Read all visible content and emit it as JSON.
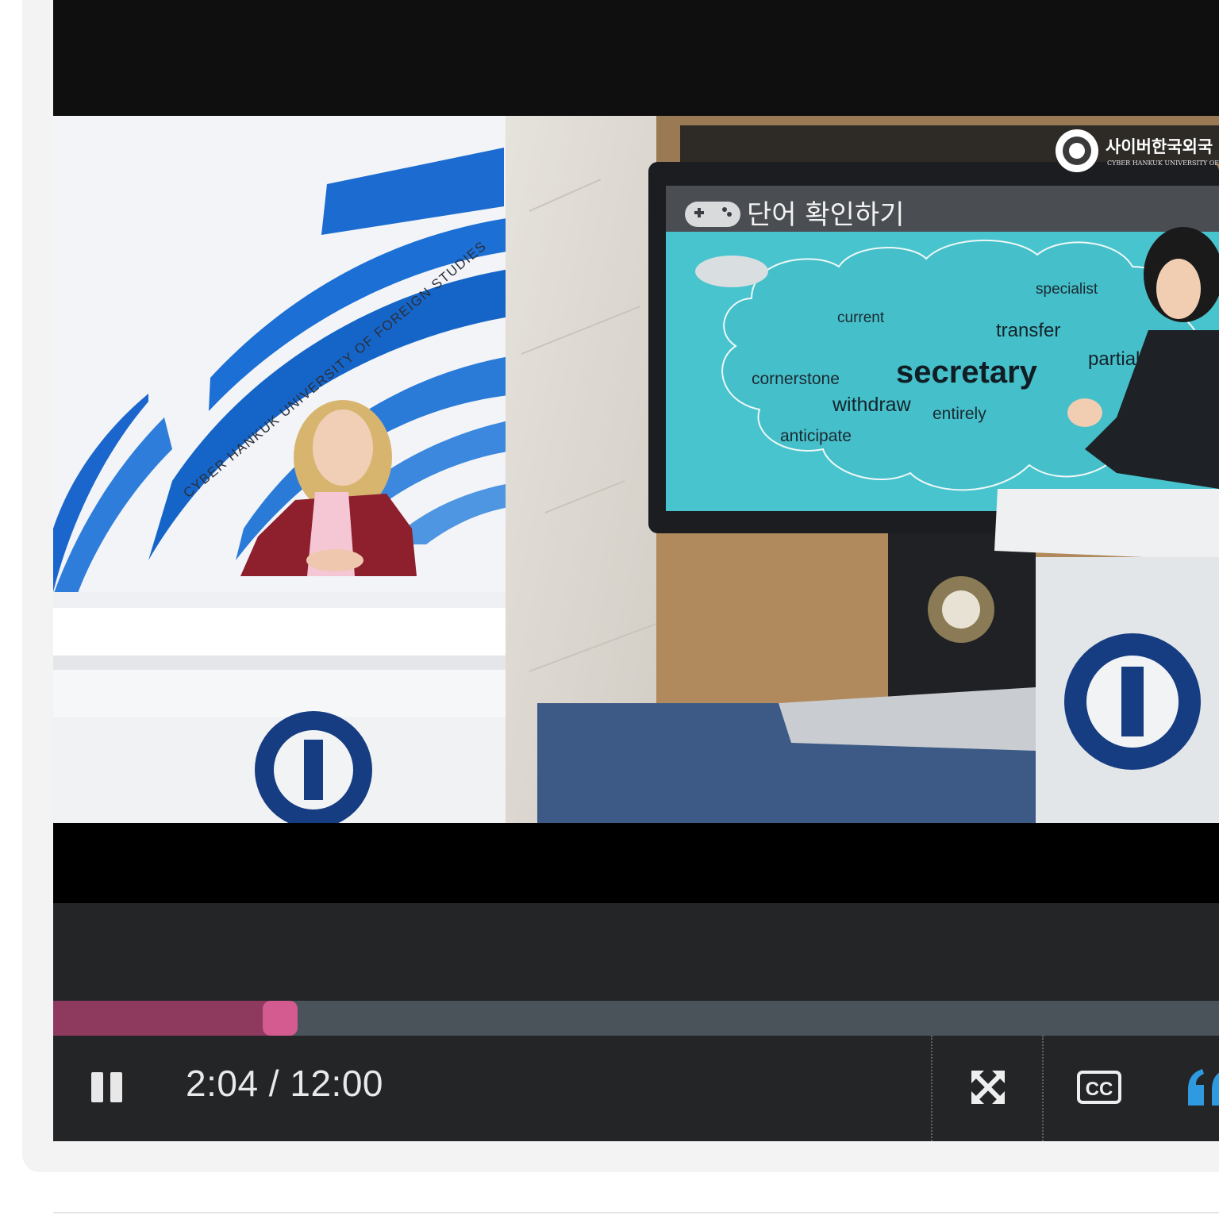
{
  "player": {
    "time": {
      "current": "2:04",
      "separator": " / ",
      "duration": "12:00"
    },
    "progress_fraction": 0.195,
    "buttons": {
      "play_pause_icon": "pause-icon",
      "fullscreen_icon": "fullscreen-icon",
      "captions_label": "CC",
      "transcript_icon": "quote-icon"
    },
    "colors": {
      "progress_fill": "#8e3a5e",
      "progress_handle": "#d45b8f",
      "progress_track": "#4b535a",
      "controls_bg": "#232527",
      "transcript_accent": "#2f9ae0"
    }
  },
  "video": {
    "studio_banner": "CYBER HANKUK UNIVERSITY OF FOREIGN STUDIES",
    "channel_logo": {
      "name_ko": "사이버한국외국",
      "name_en": "CYBER HANKUK UNIVERSITY OF"
    },
    "seal_text_ko": "사이버한국외국어대학교",
    "seal_text_en": "CYBER HANKUK UNIVERSITY OF FOREIGN STUDIES",
    "screen": {
      "title": "단어 확인하기",
      "words": [
        {
          "text": "specialist"
        },
        {
          "text": "current"
        },
        {
          "text": "transfer"
        },
        {
          "text": "secretary"
        },
        {
          "text": "partial"
        },
        {
          "text": "cornerstone"
        },
        {
          "text": "withdraw"
        },
        {
          "text": "entirely"
        },
        {
          "text": "anticipate"
        }
      ]
    }
  }
}
